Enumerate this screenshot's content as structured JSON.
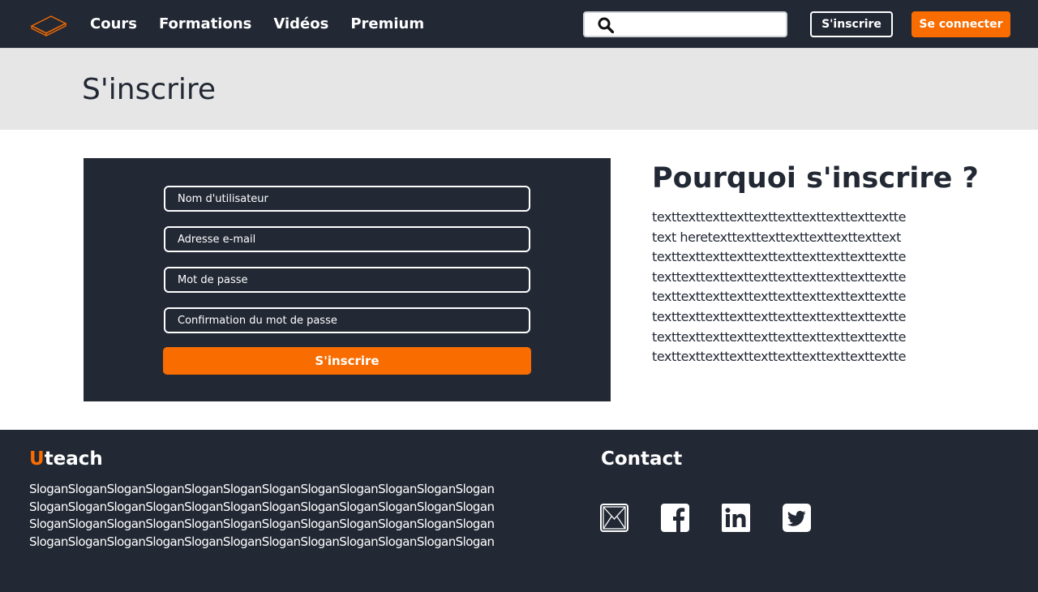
{
  "header": {
    "logo_icon": "book-logo-icon",
    "nav": [
      "Cours",
      "Formations",
      "Vidéos",
      "Premium"
    ],
    "search": {
      "placeholder": "",
      "icon": "search-icon"
    },
    "signup_label": "S'inscrire",
    "login_label": "Se connecter"
  },
  "page": {
    "title": "S'inscrire"
  },
  "form": {
    "username_placeholder": "Nom d'utilisateur",
    "email_placeholder": "Adresse e-mail",
    "password_placeholder": "Mot de passe",
    "confirm_placeholder": "Confirmation du mot de passe",
    "submit_label": "S'inscrire"
  },
  "why": {
    "title": "Pourquoi s'inscrire ?",
    "lines": [
      "texttexttexttexttexttexttexttexttexttextte",
      "text heretexttexttexttexttexttexttexttext",
      "texttexttexttexttexttexttexttexttexttextte",
      "texttexttexttexttexttexttexttexttexttextte",
      "texttexttexttexttexttexttexttexttexttextte",
      "texttexttexttexttexttexttexttexttexttextte",
      "texttexttexttexttexttexttexttexttexttextte",
      "texttexttexttexttexttexttexttexttexttextte"
    ]
  },
  "footer": {
    "brand_initial": "U",
    "brand_rest": "teach",
    "slogan_lines": [
      "SloganSloganSloganSloganSloganSloganSloganSloganSloganSloganSloganSlogan",
      "SloganSloganSloganSloganSloganSloganSloganSloganSloganSloganSloganSlogan",
      "SloganSloganSloganSloganSloganSloganSloganSloganSloganSloganSloganSlogan",
      "SloganSloganSloganSloganSloganSloganSloganSloganSloganSloganSloganSlogan"
    ],
    "contact_title": "Contact",
    "social_icons": [
      "mail-icon",
      "facebook-icon",
      "linkedin-icon",
      "twitter-icon"
    ]
  },
  "colors": {
    "dark": "#222834",
    "accent": "#f86c00",
    "band": "#e6e6e6"
  }
}
